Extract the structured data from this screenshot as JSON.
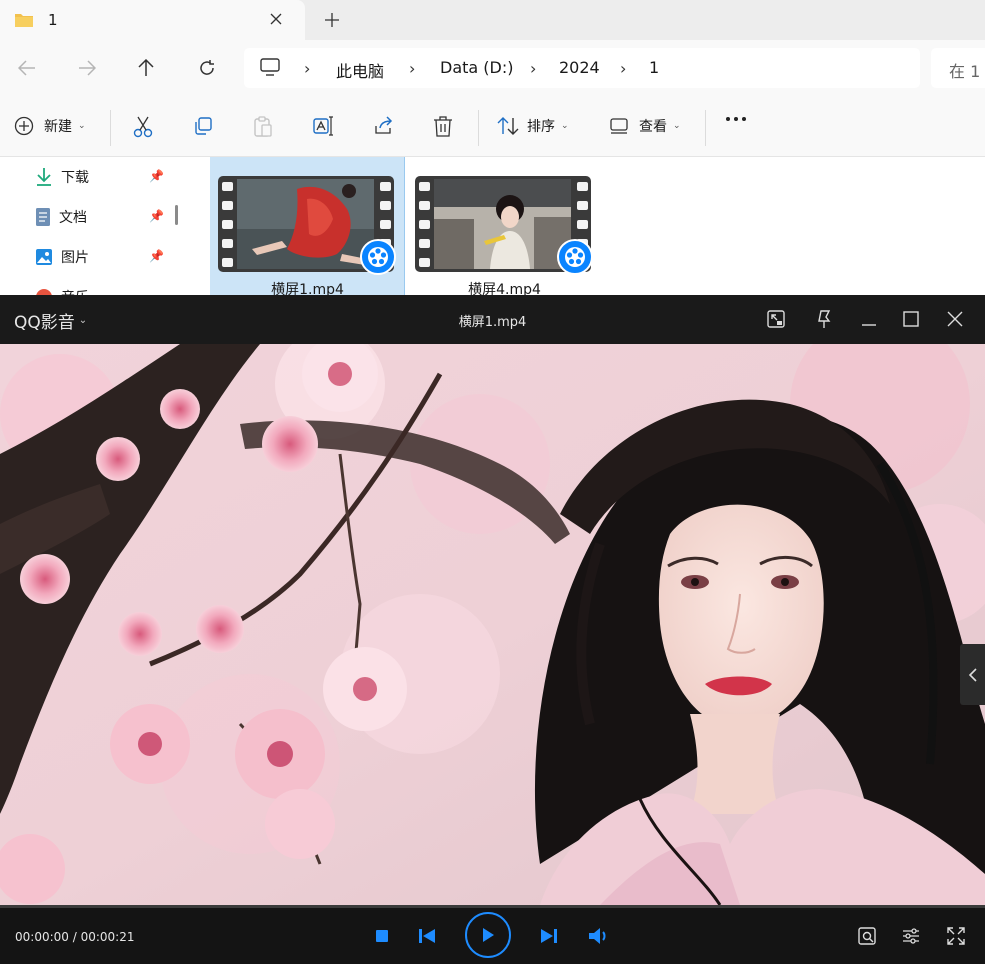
{
  "explorer": {
    "tab": {
      "title": "1"
    },
    "breadcrumb": [
      "此电脑",
      "Data (D:)",
      "2024",
      "1"
    ],
    "search_placeholder": "在 1",
    "commands": {
      "new": "新建",
      "sort": "排序",
      "view": "查看"
    },
    "sidebar": [
      {
        "label": "下载",
        "icon": "download-icon"
      },
      {
        "label": "文档",
        "icon": "document-icon"
      },
      {
        "label": "图片",
        "icon": "pictures-icon"
      },
      {
        "label": "音乐",
        "icon": "music-icon"
      }
    ],
    "files": [
      {
        "name": "横屏1.mp4",
        "selected": true
      },
      {
        "name": "横屏4.mp4",
        "selected": false
      }
    ]
  },
  "player": {
    "brand": "QQ影音",
    "file_title": "横屏1.mp4",
    "time": "00:00:00 / 00:00:21",
    "progress": 0.0
  },
  "colors": {
    "accent": "#0a84ff",
    "selection": "#cce4f7",
    "folder": "#f2c14e"
  }
}
